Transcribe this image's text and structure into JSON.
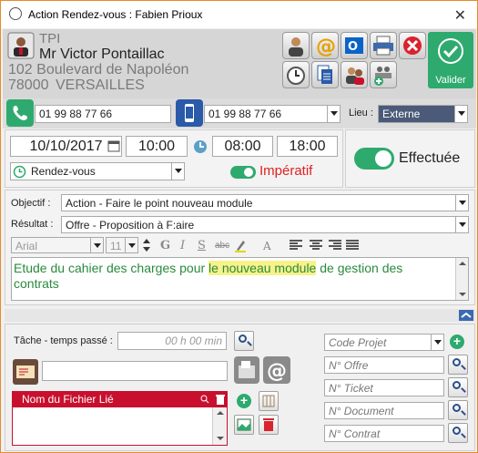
{
  "window": {
    "title": "Action Rendez-vous : Fabien Prioux",
    "close_glyph": "✕"
  },
  "contact": {
    "type": "TPI",
    "name": "Mr Victor Pontaillac",
    "address": "102 Boulevard de Napoléon",
    "postal": "78000",
    "city": "VERSAILLES"
  },
  "toolbar": {
    "validate_label": "Valider"
  },
  "phones": {
    "phone": "01 99 88 77 66",
    "mobile": "01 99 88 77 66"
  },
  "lieu": {
    "label": "Lieu :",
    "value": "Externe"
  },
  "schedule": {
    "date": "10/10/2017",
    "time": "10:00",
    "start": "08:00",
    "end": "18:00",
    "type": "Rendez-vous",
    "imperatif_label": "Impératif",
    "effectuee_label": "Effectuée"
  },
  "objectif": {
    "label": "Objectif :",
    "value": "Action - Faire le point nouveau module"
  },
  "resultat": {
    "label": "Résultat :",
    "value": "Offre - Proposition à F:aire"
  },
  "editor": {
    "font": "Arial",
    "size": "11",
    "text_before": "Etude du cahier des charges pour ",
    "text_highlight": "le nouveau module",
    "text_after": " de gestion des",
    "line2": "contrats"
  },
  "tache": {
    "label": "Tâche - temps passé :",
    "placeholder": "00 h 00 min"
  },
  "files": {
    "header": "Nom du Fichier Lié"
  },
  "right_fields": {
    "code_projet": "Code Projet",
    "offre": "N° Offre",
    "ticket": "N° Ticket",
    "document": "N° Document",
    "contrat": "N° Contrat"
  },
  "colors": {
    "accent_green": "#2eaa6f",
    "imperatif_red": "#e02020",
    "file_header_red": "#c8102e"
  }
}
